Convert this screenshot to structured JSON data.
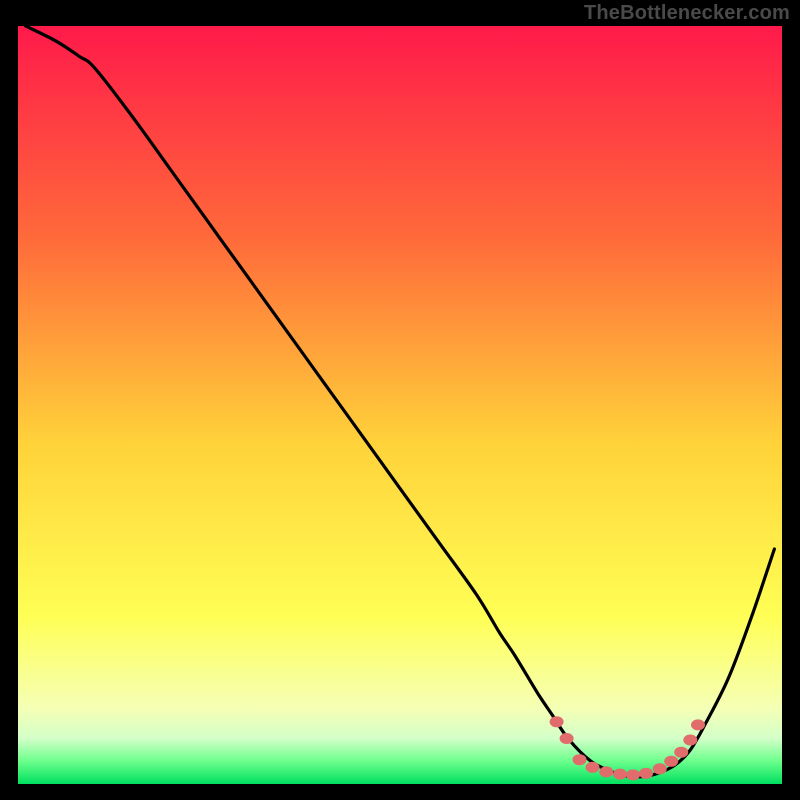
{
  "watermark": "TheBottlenecker.com",
  "colors": {
    "bg": "#000000",
    "curve": "#000000",
    "dots": "#e06c6c",
    "gradient_top": "#ff1a4a",
    "gradient_mid_upper": "#ff7a3a",
    "gradient_mid": "#ffd23a",
    "gradient_mid_lower": "#ffff55",
    "gradient_pale": "#f5ffb5",
    "gradient_green": "#00e060"
  },
  "chart_data": {
    "type": "line",
    "title": "",
    "xlabel": "",
    "ylabel": "",
    "xlim": [
      0,
      100
    ],
    "ylim": [
      0,
      100
    ],
    "grid": false,
    "legend": false,
    "series": [
      {
        "name": "curve",
        "x": [
          1,
          5,
          8,
          10,
          15,
          20,
          25,
          30,
          35,
          40,
          45,
          50,
          55,
          60,
          63,
          65,
          68,
          70,
          72,
          75,
          78,
          80,
          82,
          84,
          86,
          88,
          90,
          93,
          96,
          99
        ],
        "y": [
          100,
          98,
          96,
          94.5,
          88,
          81,
          74,
          67,
          60,
          53,
          46,
          39,
          32,
          25,
          20,
          17,
          12,
          9,
          6,
          3,
          1.5,
          1,
          1,
          1.5,
          2.5,
          4.5,
          8,
          14,
          22,
          31
        ]
      }
    ],
    "highlight_points": {
      "name": "optimal-range-dots",
      "x": [
        70.5,
        71.8,
        73.5,
        75.2,
        77.0,
        78.8,
        80.5,
        82.2,
        84.0,
        85.5,
        86.8,
        88.0,
        89.0
      ],
      "y": [
        8.2,
        6.0,
        3.2,
        2.2,
        1.6,
        1.3,
        1.2,
        1.4,
        2.0,
        3.0,
        4.2,
        5.8,
        7.8
      ]
    }
  }
}
